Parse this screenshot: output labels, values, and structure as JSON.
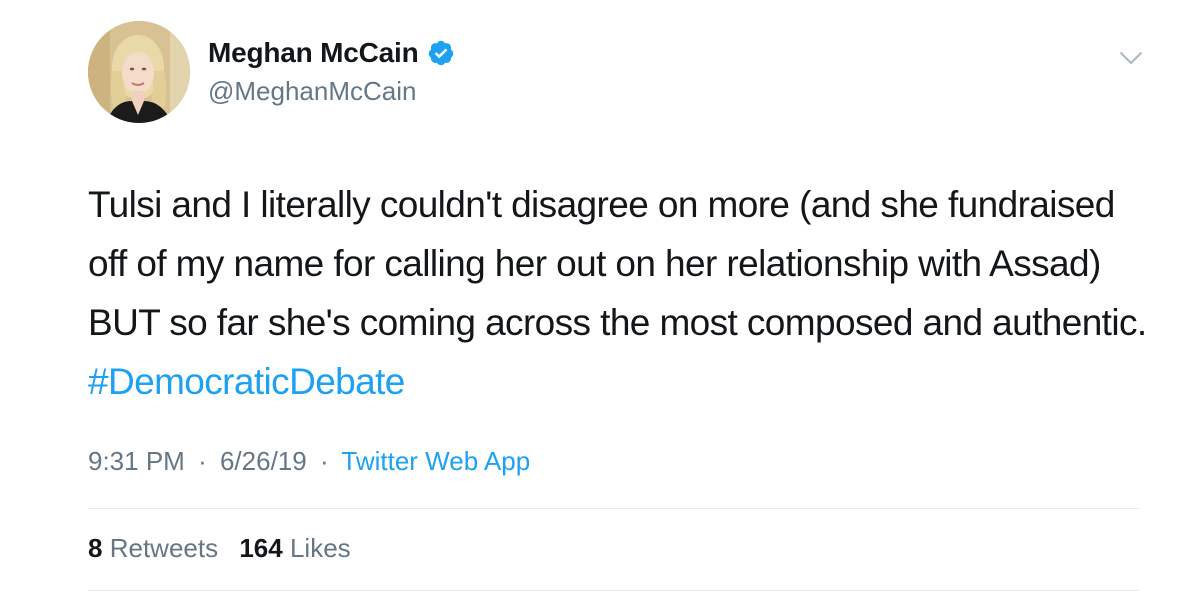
{
  "tweet": {
    "author": {
      "display_name": "Meghan McCain",
      "handle": "@MeghanMcCain",
      "verified": true,
      "avatar_icon": "profile-photo"
    },
    "text_before": "Tulsi and I literally couldn't disagree on more (and she fundraised off of my name for calling her out on her relationship with Assad) BUT so far she's coming across the most composed and authentic. ",
    "hashtag": "#DemocraticDebate",
    "time": "9:31 PM",
    "date": "6/26/19",
    "separator": "·",
    "source": "Twitter Web App",
    "stats": {
      "retweets_count": "8",
      "retweets_label": "Retweets",
      "likes_count": "164",
      "likes_label": "Likes"
    },
    "menu_icon": "chevron-down-icon"
  },
  "colors": {
    "link": "#1da1f2",
    "secondary_text": "#657786",
    "primary_text": "#14171a",
    "divider": "#e6ecf0"
  }
}
